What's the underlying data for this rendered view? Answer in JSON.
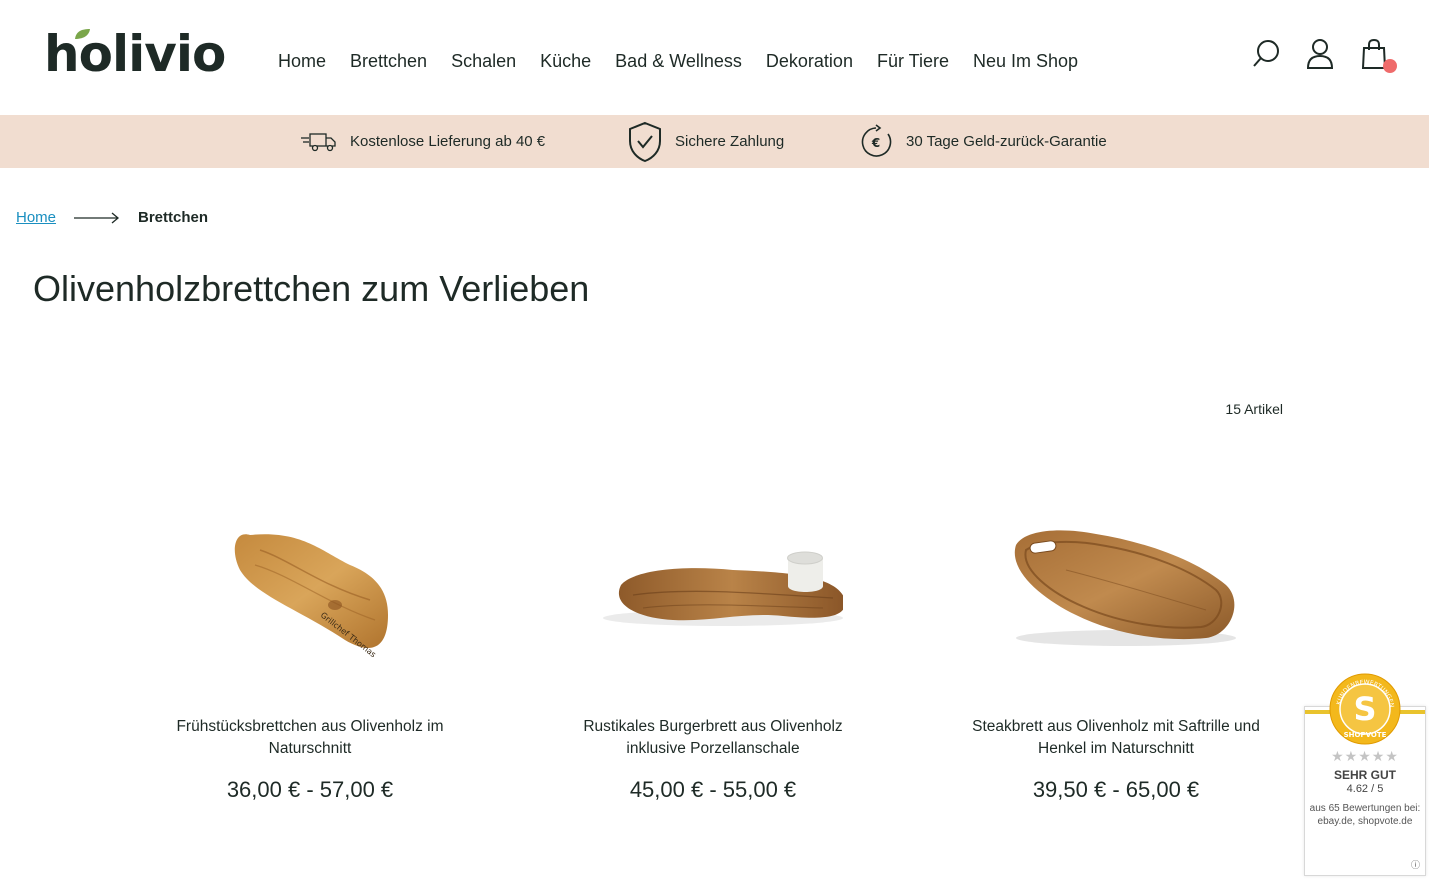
{
  "header": {
    "logo_text": "holivio",
    "nav": [
      "Home",
      "Brettchen",
      "Schalen",
      "Küche",
      "Bad & Wellness",
      "Dekoration",
      "Für Tiere",
      "Neu Im Shop"
    ],
    "icons": [
      "search-icon",
      "user-icon",
      "cart-icon"
    ],
    "accent_color": "#ef6b6b",
    "leaf_color": "#7aa64a"
  },
  "benefits": {
    "background": "#f1ddd0",
    "items": [
      {
        "icon": "delivery-truck-icon",
        "label": "Kostenlose Lieferung ab 40 €"
      },
      {
        "icon": "shield-check-icon",
        "label": "Sichere Zahlung"
      },
      {
        "icon": "money-back-icon",
        "label": "30 Tage Geld-zurück-Garantie"
      }
    ]
  },
  "breadcrumb": {
    "home": "Home",
    "current": "Brettchen"
  },
  "page": {
    "title": "Olivenholzbrettchen zum Verlieben",
    "count": "15 Artikel"
  },
  "products": [
    {
      "name": "Frühstücksbrettchen aus Olivenholz im Naturschnitt",
      "price": "36,00 € - 57,00 €",
      "engraving": "Grillchef Thomas"
    },
    {
      "name": "Rustikales Burgerbrett aus Olivenholz inklusive Porzellanschale",
      "price": "45,00 € - 55,00 €"
    },
    {
      "name": "Steakbrett aus Olivenholz mit Saftrille und Henkel im Naturschnitt",
      "price": "39,50 € - 65,00 €"
    }
  ],
  "shopvote": {
    "seal_letter": "S",
    "seal_ring_text": "KUNDENBEWERTUNGEN",
    "seal_brand": "SHOPVOTE",
    "stars": "★★★★★",
    "rating_label": "SEHR GUT",
    "score": "4.62 / 5",
    "reviews": "aus 65 Bewertungen bei: ebay.de, shopvote.de",
    "info": "ⓘ"
  }
}
